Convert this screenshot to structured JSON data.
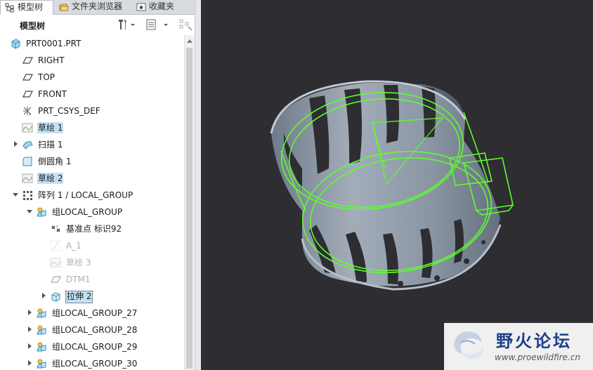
{
  "tabs": [
    {
      "label": "模型树",
      "icon": "model-tree-icon",
      "active": true
    },
    {
      "label": "文件夹浏览器",
      "icon": "folder-browser-icon",
      "active": false
    },
    {
      "label": "收藏夹",
      "icon": "favorites-icon",
      "active": false
    }
  ],
  "tree_header": {
    "title": "模型树"
  },
  "tree": [
    {
      "label": "PRT0001.PRT",
      "icon": "part-icon",
      "depth": 0,
      "expander": "none",
      "style": "normal"
    },
    {
      "label": "RIGHT",
      "icon": "datum-plane-icon",
      "depth": 1,
      "expander": "none",
      "style": "normal"
    },
    {
      "label": "TOP",
      "icon": "datum-plane-icon",
      "depth": 1,
      "expander": "none",
      "style": "normal"
    },
    {
      "label": "FRONT",
      "icon": "datum-plane-icon",
      "depth": 1,
      "expander": "none",
      "style": "normal"
    },
    {
      "label": "PRT_CSYS_DEF",
      "icon": "csys-icon",
      "depth": 1,
      "expander": "none",
      "style": "normal"
    },
    {
      "label": "草绘 1",
      "icon": "sketch-icon",
      "depth": 1,
      "expander": "none",
      "style": "highlight"
    },
    {
      "label": "扫描 1",
      "icon": "sweep-icon",
      "depth": 1,
      "expander": "collapsed",
      "style": "normal"
    },
    {
      "label": "倒圆角 1",
      "icon": "round-icon",
      "depth": 1,
      "expander": "none",
      "style": "normal"
    },
    {
      "label": "草绘 2",
      "icon": "sketch-icon",
      "depth": 1,
      "expander": "none",
      "style": "highlight"
    },
    {
      "label": "阵列 1 / LOCAL_GROUP",
      "icon": "pattern-icon",
      "depth": 1,
      "expander": "expanded",
      "style": "normal"
    },
    {
      "label": "组LOCAL_GROUP",
      "icon": "group-icon",
      "depth": 2,
      "expander": "expanded",
      "style": "normal"
    },
    {
      "label": "基准点 标识92",
      "icon": "datum-point-icon",
      "depth": 3,
      "expander": "none",
      "style": "normal"
    },
    {
      "label": "A_1",
      "icon": "datum-axis-icon",
      "depth": 3,
      "expander": "none",
      "style": "dim"
    },
    {
      "label": "草绘 3",
      "icon": "sketch-icon",
      "depth": 3,
      "expander": "none",
      "style": "dim"
    },
    {
      "label": "DTM1",
      "icon": "datum-plane-icon",
      "depth": 3,
      "expander": "none",
      "style": "dim"
    },
    {
      "label": "拉伸 2",
      "icon": "extrude-icon",
      "depth": 3,
      "expander": "collapsed",
      "style": "selected"
    },
    {
      "label": "组LOCAL_GROUP_27",
      "icon": "group-icon",
      "depth": 2,
      "expander": "collapsed",
      "style": "normal"
    },
    {
      "label": "组LOCAL_GROUP_28",
      "icon": "group-icon",
      "depth": 2,
      "expander": "collapsed",
      "style": "normal"
    },
    {
      "label": "组LOCAL_GROUP_29",
      "icon": "group-icon",
      "depth": 2,
      "expander": "collapsed",
      "style": "normal"
    },
    {
      "label": "组LOCAL_GROUP_30",
      "icon": "group-icon",
      "depth": 2,
      "expander": "collapsed",
      "style": "normal"
    }
  ],
  "toolbar_icons": [
    "zoom-fit-icon",
    "zoom-in-icon",
    "zoom-out-icon",
    "repaint-icon",
    "spin-center-icon",
    "saved-views-icon",
    "display-style-icon"
  ],
  "watermark": {
    "title": "野火论坛",
    "url": "www.proewildfire.cn"
  },
  "colors": {
    "viewport_bg": "#2d2d32",
    "model_surface": "#8c97a6",
    "highlight_green": "#5cff2a",
    "selection_bg": "#c2e1f5"
  }
}
